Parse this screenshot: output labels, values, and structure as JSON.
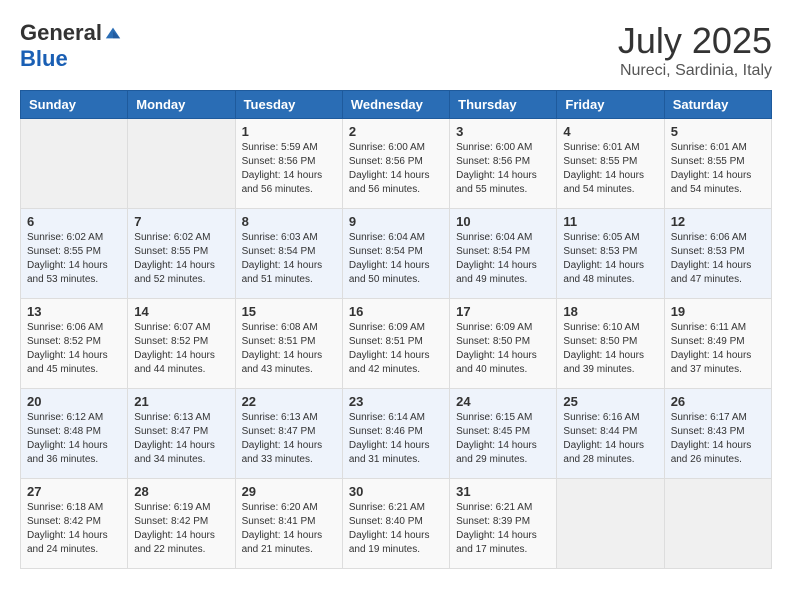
{
  "logo": {
    "general": "General",
    "blue": "Blue"
  },
  "title": {
    "month": "July 2025",
    "location": "Nureci, Sardinia, Italy"
  },
  "headers": [
    "Sunday",
    "Monday",
    "Tuesday",
    "Wednesday",
    "Thursday",
    "Friday",
    "Saturday"
  ],
  "weeks": [
    [
      {
        "day": "",
        "sunrise": "",
        "sunset": "",
        "daylight": ""
      },
      {
        "day": "",
        "sunrise": "",
        "sunset": "",
        "daylight": ""
      },
      {
        "day": "1",
        "sunrise": "Sunrise: 5:59 AM",
        "sunset": "Sunset: 8:56 PM",
        "daylight": "Daylight: 14 hours and 56 minutes."
      },
      {
        "day": "2",
        "sunrise": "Sunrise: 6:00 AM",
        "sunset": "Sunset: 8:56 PM",
        "daylight": "Daylight: 14 hours and 56 minutes."
      },
      {
        "day": "3",
        "sunrise": "Sunrise: 6:00 AM",
        "sunset": "Sunset: 8:56 PM",
        "daylight": "Daylight: 14 hours and 55 minutes."
      },
      {
        "day": "4",
        "sunrise": "Sunrise: 6:01 AM",
        "sunset": "Sunset: 8:55 PM",
        "daylight": "Daylight: 14 hours and 54 minutes."
      },
      {
        "day": "5",
        "sunrise": "Sunrise: 6:01 AM",
        "sunset": "Sunset: 8:55 PM",
        "daylight": "Daylight: 14 hours and 54 minutes."
      }
    ],
    [
      {
        "day": "6",
        "sunrise": "Sunrise: 6:02 AM",
        "sunset": "Sunset: 8:55 PM",
        "daylight": "Daylight: 14 hours and 53 minutes."
      },
      {
        "day": "7",
        "sunrise": "Sunrise: 6:02 AM",
        "sunset": "Sunset: 8:55 PM",
        "daylight": "Daylight: 14 hours and 52 minutes."
      },
      {
        "day": "8",
        "sunrise": "Sunrise: 6:03 AM",
        "sunset": "Sunset: 8:54 PM",
        "daylight": "Daylight: 14 hours and 51 minutes."
      },
      {
        "day": "9",
        "sunrise": "Sunrise: 6:04 AM",
        "sunset": "Sunset: 8:54 PM",
        "daylight": "Daylight: 14 hours and 50 minutes."
      },
      {
        "day": "10",
        "sunrise": "Sunrise: 6:04 AM",
        "sunset": "Sunset: 8:54 PM",
        "daylight": "Daylight: 14 hours and 49 minutes."
      },
      {
        "day": "11",
        "sunrise": "Sunrise: 6:05 AM",
        "sunset": "Sunset: 8:53 PM",
        "daylight": "Daylight: 14 hours and 48 minutes."
      },
      {
        "day": "12",
        "sunrise": "Sunrise: 6:06 AM",
        "sunset": "Sunset: 8:53 PM",
        "daylight": "Daylight: 14 hours and 47 minutes."
      }
    ],
    [
      {
        "day": "13",
        "sunrise": "Sunrise: 6:06 AM",
        "sunset": "Sunset: 8:52 PM",
        "daylight": "Daylight: 14 hours and 45 minutes."
      },
      {
        "day": "14",
        "sunrise": "Sunrise: 6:07 AM",
        "sunset": "Sunset: 8:52 PM",
        "daylight": "Daylight: 14 hours and 44 minutes."
      },
      {
        "day": "15",
        "sunrise": "Sunrise: 6:08 AM",
        "sunset": "Sunset: 8:51 PM",
        "daylight": "Daylight: 14 hours and 43 minutes."
      },
      {
        "day": "16",
        "sunrise": "Sunrise: 6:09 AM",
        "sunset": "Sunset: 8:51 PM",
        "daylight": "Daylight: 14 hours and 42 minutes."
      },
      {
        "day": "17",
        "sunrise": "Sunrise: 6:09 AM",
        "sunset": "Sunset: 8:50 PM",
        "daylight": "Daylight: 14 hours and 40 minutes."
      },
      {
        "day": "18",
        "sunrise": "Sunrise: 6:10 AM",
        "sunset": "Sunset: 8:50 PM",
        "daylight": "Daylight: 14 hours and 39 minutes."
      },
      {
        "day": "19",
        "sunrise": "Sunrise: 6:11 AM",
        "sunset": "Sunset: 8:49 PM",
        "daylight": "Daylight: 14 hours and 37 minutes."
      }
    ],
    [
      {
        "day": "20",
        "sunrise": "Sunrise: 6:12 AM",
        "sunset": "Sunset: 8:48 PM",
        "daylight": "Daylight: 14 hours and 36 minutes."
      },
      {
        "day": "21",
        "sunrise": "Sunrise: 6:13 AM",
        "sunset": "Sunset: 8:47 PM",
        "daylight": "Daylight: 14 hours and 34 minutes."
      },
      {
        "day": "22",
        "sunrise": "Sunrise: 6:13 AM",
        "sunset": "Sunset: 8:47 PM",
        "daylight": "Daylight: 14 hours and 33 minutes."
      },
      {
        "day": "23",
        "sunrise": "Sunrise: 6:14 AM",
        "sunset": "Sunset: 8:46 PM",
        "daylight": "Daylight: 14 hours and 31 minutes."
      },
      {
        "day": "24",
        "sunrise": "Sunrise: 6:15 AM",
        "sunset": "Sunset: 8:45 PM",
        "daylight": "Daylight: 14 hours and 29 minutes."
      },
      {
        "day": "25",
        "sunrise": "Sunrise: 6:16 AM",
        "sunset": "Sunset: 8:44 PM",
        "daylight": "Daylight: 14 hours and 28 minutes."
      },
      {
        "day": "26",
        "sunrise": "Sunrise: 6:17 AM",
        "sunset": "Sunset: 8:43 PM",
        "daylight": "Daylight: 14 hours and 26 minutes."
      }
    ],
    [
      {
        "day": "27",
        "sunrise": "Sunrise: 6:18 AM",
        "sunset": "Sunset: 8:42 PM",
        "daylight": "Daylight: 14 hours and 24 minutes."
      },
      {
        "day": "28",
        "sunrise": "Sunrise: 6:19 AM",
        "sunset": "Sunset: 8:42 PM",
        "daylight": "Daylight: 14 hours and 22 minutes."
      },
      {
        "day": "29",
        "sunrise": "Sunrise: 6:20 AM",
        "sunset": "Sunset: 8:41 PM",
        "daylight": "Daylight: 14 hours and 21 minutes."
      },
      {
        "day": "30",
        "sunrise": "Sunrise: 6:21 AM",
        "sunset": "Sunset: 8:40 PM",
        "daylight": "Daylight: 14 hours and 19 minutes."
      },
      {
        "day": "31",
        "sunrise": "Sunrise: 6:21 AM",
        "sunset": "Sunset: 8:39 PM",
        "daylight": "Daylight: 14 hours and 17 minutes."
      },
      {
        "day": "",
        "sunrise": "",
        "sunset": "",
        "daylight": ""
      },
      {
        "day": "",
        "sunrise": "",
        "sunset": "",
        "daylight": ""
      }
    ]
  ]
}
